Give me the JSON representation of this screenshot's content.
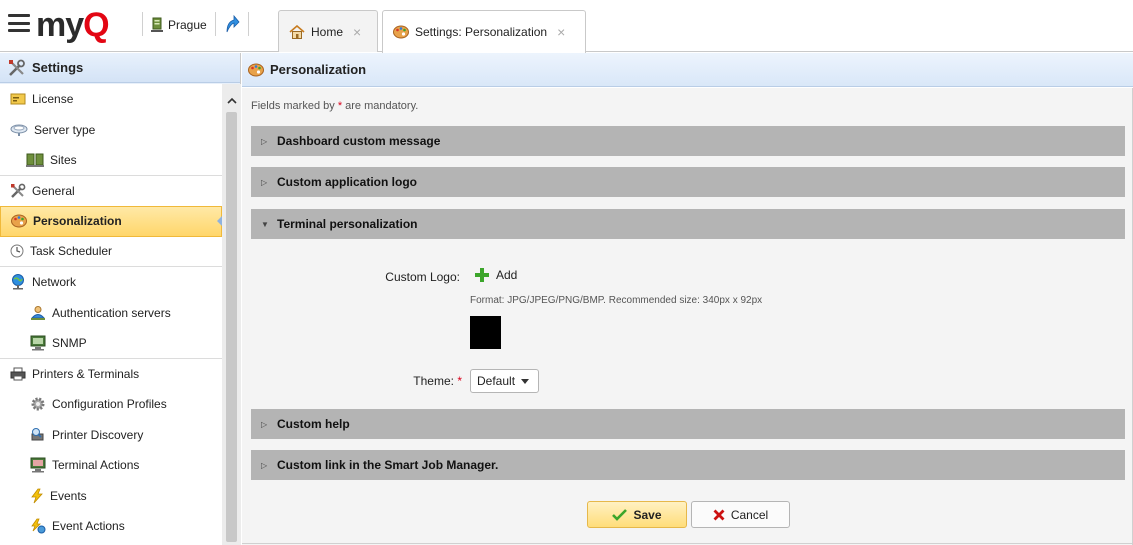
{
  "app": {
    "logo_text": "myQ",
    "server": "Prague"
  },
  "tabs": [
    {
      "label": "Home",
      "icon": "home-icon"
    },
    {
      "label": "Settings: Personalization",
      "icon": "palette-icon"
    }
  ],
  "sidebar": {
    "title": "Settings",
    "items": [
      {
        "label": "License",
        "icon": "license-icon"
      },
      {
        "label": "Server type",
        "icon": "server-type-icon"
      },
      {
        "label": "Sites",
        "icon": "sites-icon"
      },
      {
        "label": "General",
        "icon": "tools-icon"
      },
      {
        "label": "Personalization",
        "icon": "palette-icon"
      },
      {
        "label": "Task Scheduler",
        "icon": "clock-icon"
      },
      {
        "label": "Network",
        "icon": "network-icon"
      },
      {
        "label": "Authentication servers",
        "icon": "user-server-icon"
      },
      {
        "label": "SNMP",
        "icon": "monitor-icon"
      },
      {
        "label": "Printers & Terminals",
        "icon": "printer-icon"
      },
      {
        "label": "Configuration Profiles",
        "icon": "gear-icon"
      },
      {
        "label": "Printer Discovery",
        "icon": "discovery-icon"
      },
      {
        "label": "Terminal Actions",
        "icon": "terminal-icon"
      },
      {
        "label": "Events",
        "icon": "lightning-icon"
      },
      {
        "label": "Event Actions",
        "icon": "event-action-icon"
      }
    ]
  },
  "main": {
    "title": "Personalization",
    "mandatory_prefix": "Fields marked by ",
    "mandatory_star": "*",
    "mandatory_suffix": " are mandatory.",
    "sections": [
      {
        "label": "Dashboard custom message",
        "expanded": false
      },
      {
        "label": "Custom application logo",
        "expanded": false
      },
      {
        "label": "Terminal personalization",
        "expanded": true
      },
      {
        "label": "Custom help",
        "expanded": false
      },
      {
        "label": "Custom link in the Smart Job Manager.",
        "expanded": false
      }
    ],
    "custom_logo_label": "Custom Logo:",
    "add_label": "Add",
    "format_hint": "Format: JPG/JPEG/PNG/BMP. Recommended size: 340px x 92px",
    "theme_label": "Theme:",
    "theme_required": "*",
    "theme_value": "Default",
    "save_label": "Save",
    "cancel_label": "Cancel"
  },
  "colors": {
    "brand_red": "#e30613",
    "active_nav": "#ffd66b",
    "section_bar": "#b4b4b4",
    "add_green": "#3ca52a",
    "cancel_red": "#cc1111"
  }
}
